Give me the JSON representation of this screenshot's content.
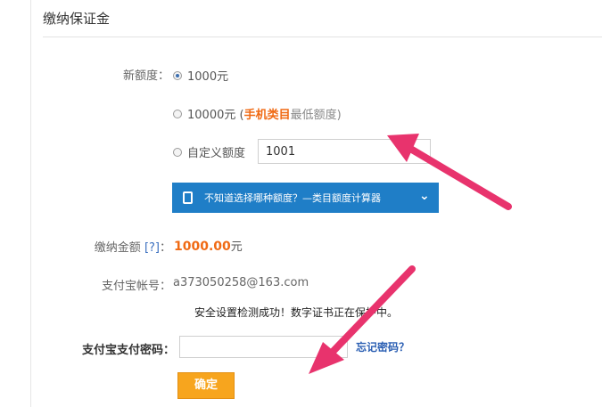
{
  "page": {
    "title": "缴纳保证金"
  },
  "form": {
    "quota_label": "新额度：",
    "options": [
      {
        "label": "1000元",
        "checked": true
      },
      {
        "label_prefix": "10000元 (",
        "label_accent": "手机类目",
        "label_suffix": "最低额度)",
        "checked": false
      },
      {
        "label": "自定义额度",
        "checked": false
      }
    ],
    "custom_amount_value": "1001",
    "calculator": {
      "text": "不知道选择哪种额度？—类目额度计算器",
      "chevron_icon": "chevron-down-icon"
    },
    "amount_label": "缴纳金额",
    "amount_help": "[?]",
    "amount_colon": "：",
    "amount_value": "1000.00",
    "amount_unit": "元",
    "account_label": "支付宝帐号：",
    "account_value": "a373050258@163.com",
    "security_notice": "安全设置检测成功！数字证书正在保护中。",
    "password_label": "支付宝支付密码：",
    "password_value": "",
    "forgot_password": "忘记密码？",
    "submit_label": "确定"
  },
  "colors": {
    "accent": "#f06a14",
    "calc_bar": "#1f7ec7",
    "button": "#f7a51e",
    "arrow": "#e8336d",
    "link": "#2b5fb3"
  }
}
